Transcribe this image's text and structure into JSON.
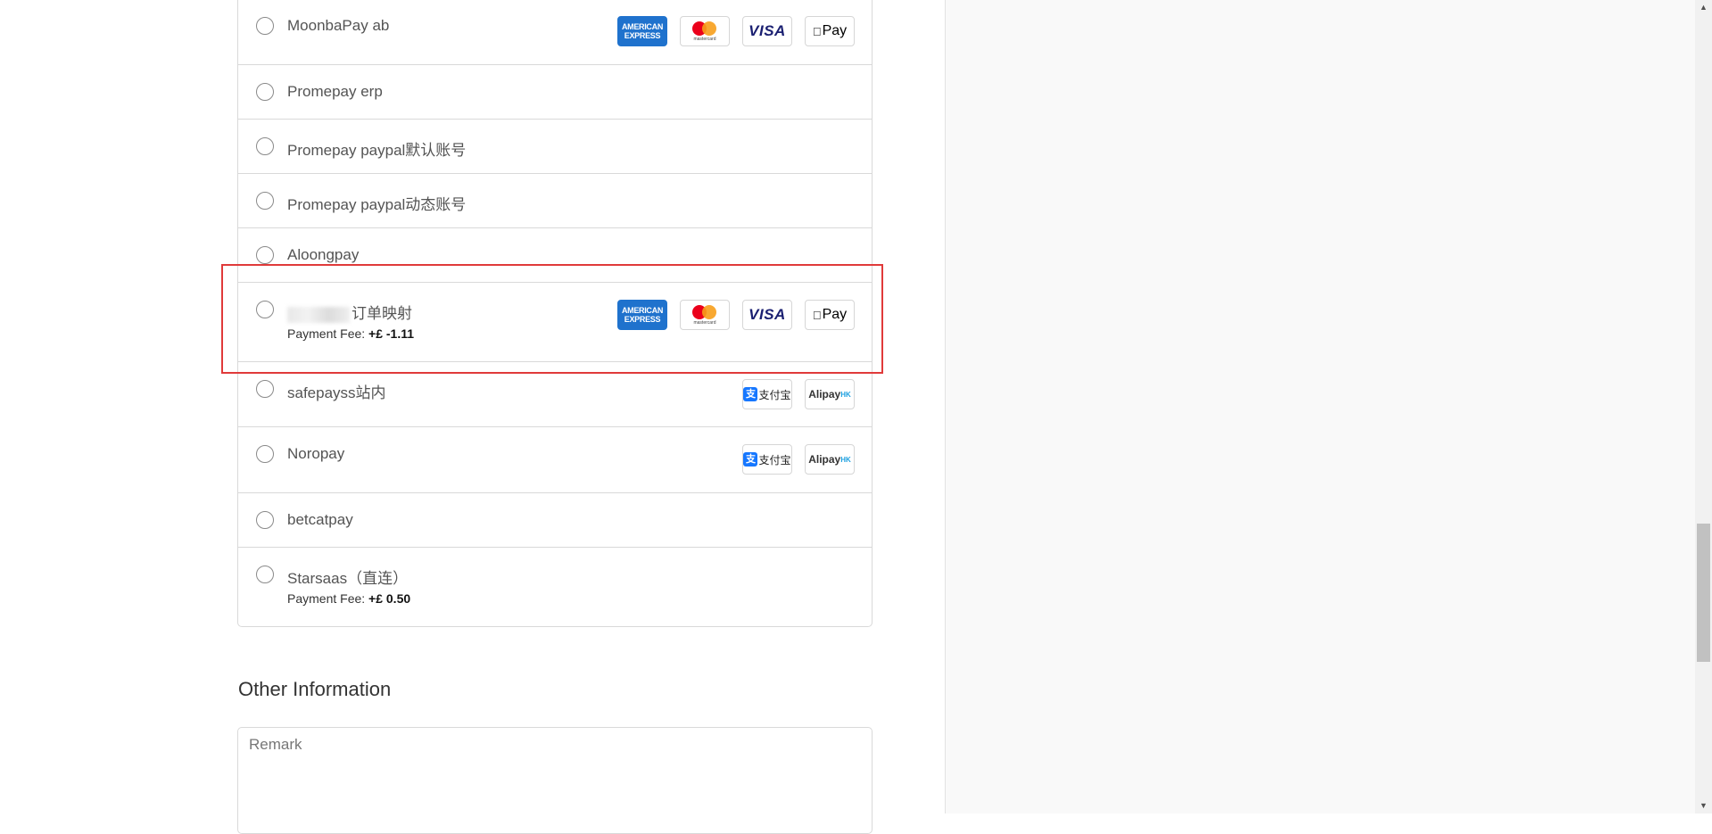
{
  "payment_methods": [
    {
      "label": "MoonbaPay ab",
      "icons": [
        "amex",
        "mastercard",
        "visa",
        "apple-pay"
      ]
    },
    {
      "label": "Promepay erp"
    },
    {
      "label": "Promepay paypal默认账号"
    },
    {
      "label": "Promepay paypal动态账号"
    },
    {
      "label": "Aloongpay"
    },
    {
      "label": "订单映射",
      "fee_label": "Payment Fee:",
      "fee_value": "+£ -1.11",
      "icons": [
        "amex",
        "mastercard",
        "visa",
        "apple-pay"
      ],
      "label_partially_obscured": true
    },
    {
      "label": "safepayss站内",
      "icons": [
        "alipay",
        "alipay-hk"
      ]
    },
    {
      "label": "Noropay",
      "icons": [
        "alipay",
        "alipay-hk"
      ]
    },
    {
      "label": "betcatpay"
    },
    {
      "label": "Starsaas（直连）",
      "fee_label": "Payment Fee:",
      "fee_value": "+£ 0.50"
    }
  ],
  "card_text": {
    "amex_line1": "AMERICAN",
    "amex_line2": "EXPRESS",
    "mastercard": "mastercard",
    "visa": "VISA",
    "apple_pay": "Pay",
    "alipay_mark": "支",
    "alipay": "支付宝",
    "alipayhk": "Alipay",
    "alipayhk_suffix": "HK"
  },
  "other_information": {
    "title": "Other Information",
    "remark_placeholder": "Remark"
  },
  "highlight_color": "#e03a3a"
}
